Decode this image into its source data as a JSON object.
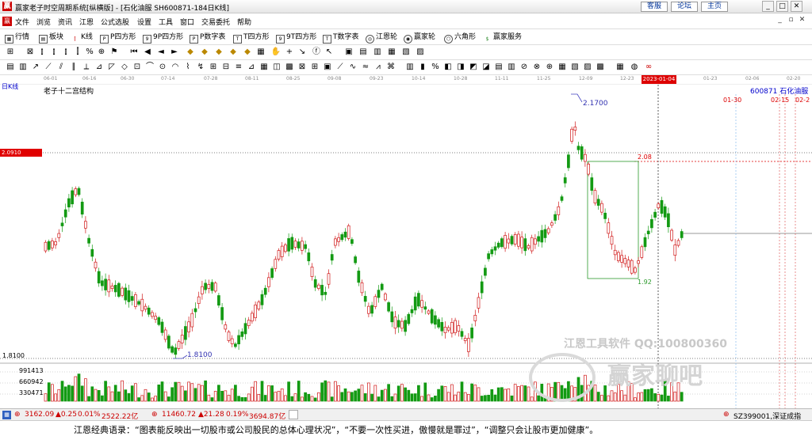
{
  "window": {
    "title": "赢家老子时空周期系统[纵横版] - [石化油服  SH600871-184日K线]",
    "links": [
      "客服",
      "论坛",
      "主页"
    ]
  },
  "menu": [
    "文件",
    "浏览",
    "资讯",
    "江恩",
    "公式选股",
    "设置",
    "工具",
    "窗口",
    "交易委托",
    "帮助"
  ],
  "toolbar1": [
    {
      "label": "行情",
      "icon": "grid-icon"
    },
    {
      "label": "板块",
      "icon": "blocks-icon"
    },
    {
      "label": "K线",
      "icon": "candle-icon"
    },
    {
      "label": "P四方形",
      "icon": "p-square-icon"
    },
    {
      "label": "9P四方形",
      "icon": "9p-square-icon"
    },
    {
      "label": "P数字表",
      "icon": "p-table-icon"
    },
    {
      "label": "T四方形",
      "icon": "t-square-icon"
    },
    {
      "label": "9T四方形",
      "icon": "9t-square-icon"
    },
    {
      "label": "T数字表",
      "icon": "t-table-icon"
    },
    {
      "label": "江恩轮",
      "icon": "gann-wheel-icon"
    },
    {
      "label": "赢家轮",
      "icon": "winner-wheel-icon"
    },
    {
      "label": "六角形",
      "icon": "hexagon-icon"
    },
    {
      "label": "赢家服务",
      "icon": "dollar-icon"
    }
  ],
  "dates": [
    "06-01",
    "06-16",
    "06-30",
    "07-14",
    "07-28",
    "08-11",
    "08-25",
    "09-08",
    "09-23",
    "10-14",
    "10-28",
    "11-11",
    "11-25",
    "12-09",
    "12-23",
    "2023-01-04",
    "01-23",
    "02-06",
    "02-20"
  ],
  "chart": {
    "period_label": "日K线",
    "structure_label": "老子十二宫结构",
    "symbol_label": "600871  石化油服",
    "current_price_label": "2.0910",
    "high_label": "2.1700",
    "low_label": "1.8100",
    "y_min_label": "1.8100",
    "box_top_label": "2.08",
    "box_bottom_label": "1.92",
    "cycle_labels": [
      "01-30",
      "02-15",
      "02-2"
    ],
    "vol_labels": [
      "991413",
      "660942",
      "330471"
    ]
  },
  "chart_data": {
    "type": "candlestick",
    "title": "老子十二宫结构",
    "symbol": "600871",
    "name": "石化油服",
    "high": 2.17,
    "low": 1.81,
    "current": 2.091,
    "box": {
      "top": 2.08,
      "bottom": 1.92
    },
    "volume_ticks": [
      991413,
      660942,
      330471
    ]
  },
  "status": {
    "sh_index": "3162.09",
    "sh_change": "▲0.25",
    "sh_pct": "0.01%",
    "sh_amount": "2522.22亿",
    "sz_index": "11460.72",
    "sz_change": "▲21.28",
    "sz_pct": "0.19%",
    "sz_amount": "3694.87亿",
    "right_code": "SZ399001,深证成指"
  },
  "quote": "江恩经典语录：“图表能反映出一切股市或公司股民的总体心理状况”，“不要一次性买进，傲慢就是罪过”，“调整只会让股市更加健康”。",
  "watermark": {
    "line1": "江恩工具软件   QQ:100800360",
    "line2": "赢家聊吧"
  }
}
